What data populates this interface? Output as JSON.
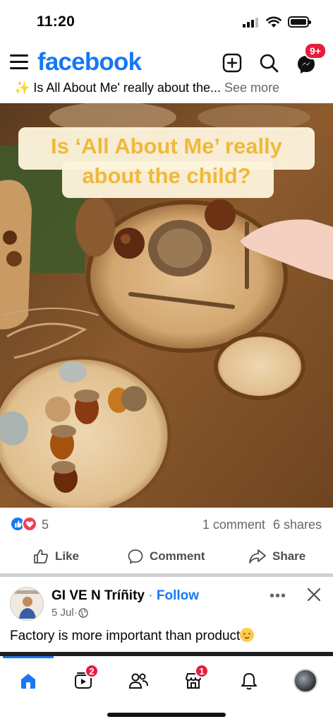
{
  "status_bar": {
    "time": "11:20"
  },
  "header": {
    "brand": "facebook",
    "messenger_badge": "9+",
    "icons": [
      "menu-icon",
      "add-icon",
      "search-icon",
      "messenger-icon"
    ]
  },
  "post": {
    "text_preview": "✨ Is All About Me' really about the...",
    "see_more": "See more",
    "image_overlay_line1": "Is ‘All About Me’ really",
    "image_overlay_line2": "about the child?",
    "reaction_count": "5",
    "comments": "1 comment",
    "shares": "6 shares",
    "actions": {
      "like": "Like",
      "comment": "Comment",
      "share": "Share"
    }
  },
  "next_post": {
    "author": "GI VE N Tríñity",
    "separator": " · ",
    "follow": "Follow",
    "date": "5 Jul",
    "meta_separator": " · ",
    "more": "•••",
    "text": "Factory is more important than product"
  },
  "bottom_nav": {
    "items": [
      {
        "name": "home",
        "badge": ""
      },
      {
        "name": "video",
        "badge": "2"
      },
      {
        "name": "friends",
        "badge": ""
      },
      {
        "name": "marketplace",
        "badge": "1"
      },
      {
        "name": "notifications",
        "badge": ""
      },
      {
        "name": "profile",
        "badge": ""
      }
    ]
  },
  "colors": {
    "brand": "#1877f2",
    "badge": "#e41e3f",
    "overlay_text": "#f0b93b",
    "overlay_bg": "#fdf4dc"
  }
}
